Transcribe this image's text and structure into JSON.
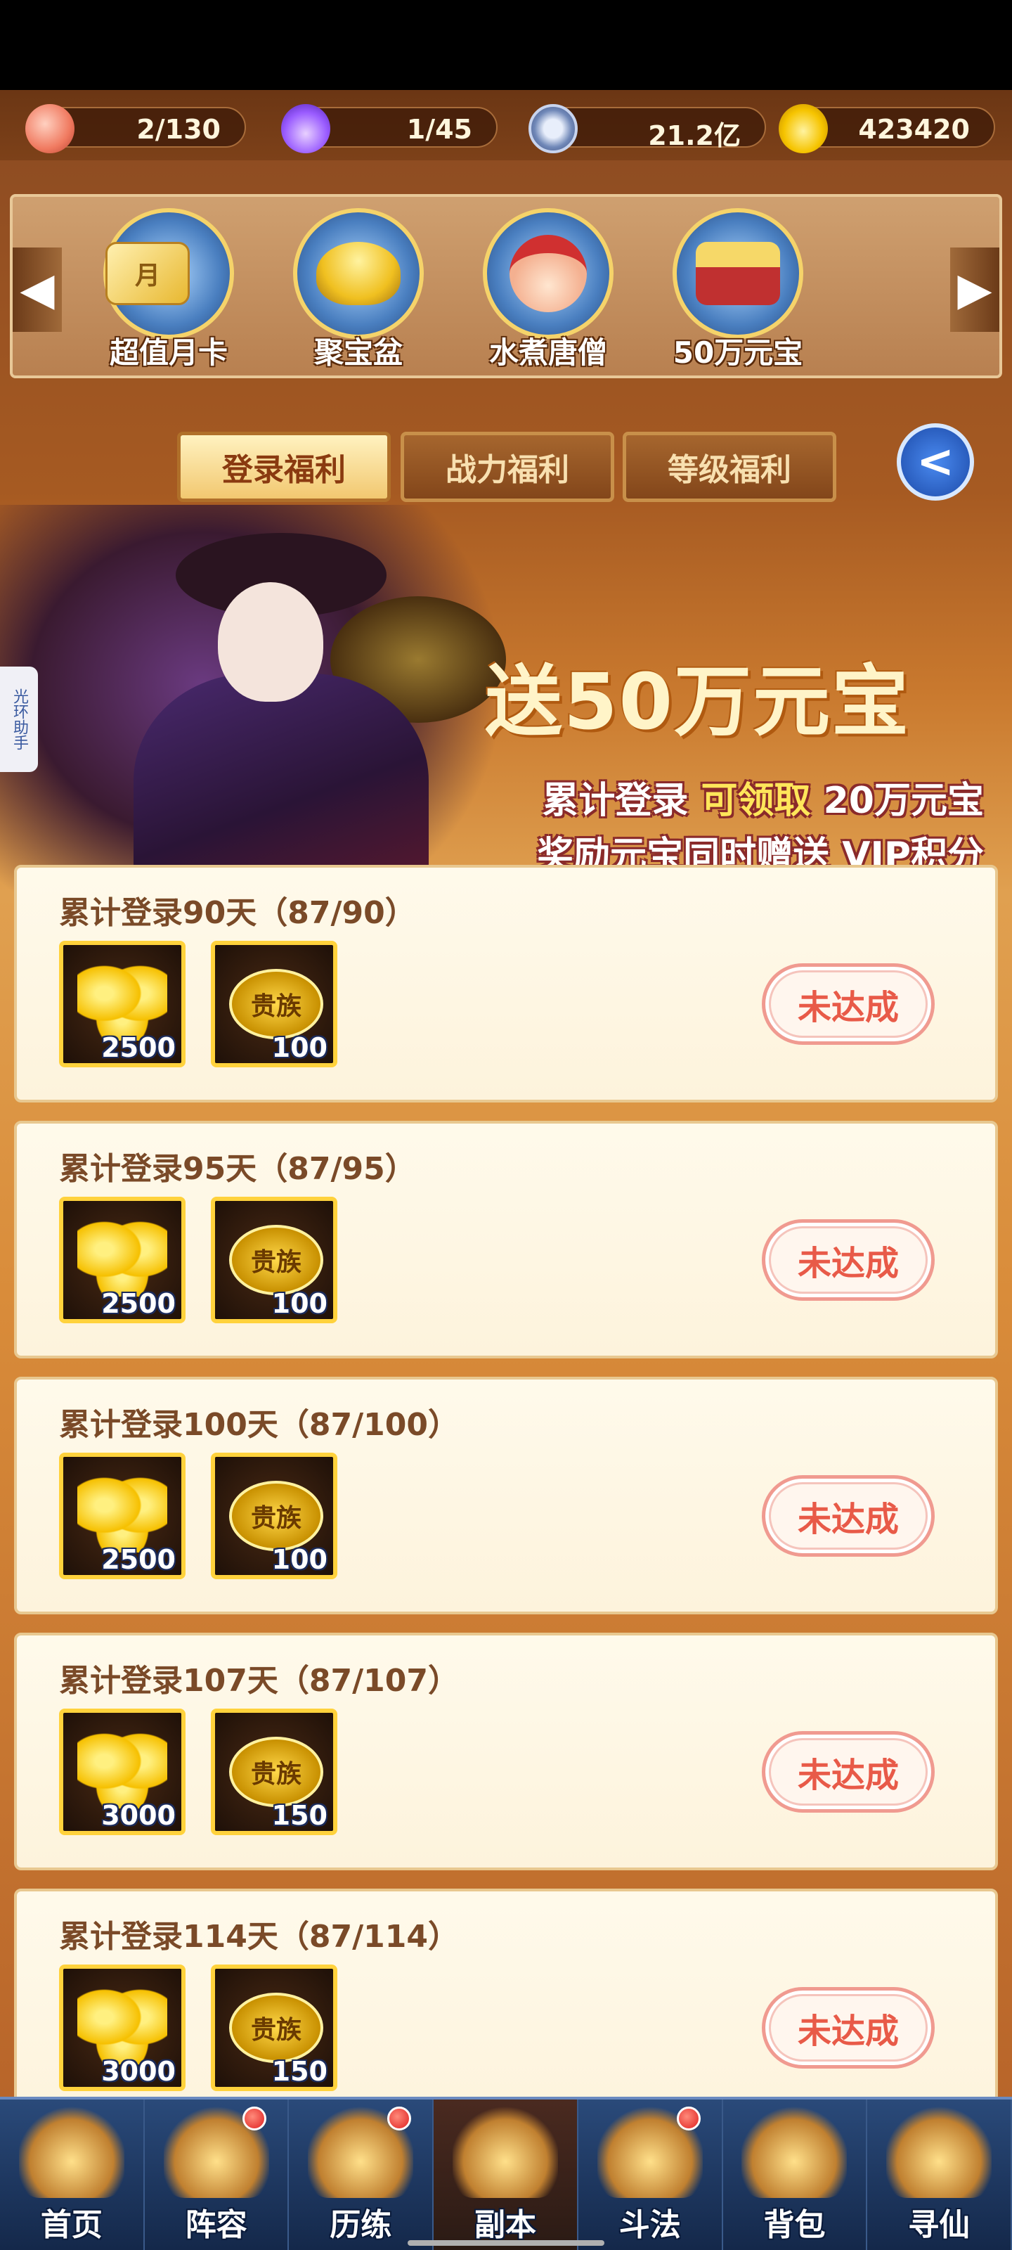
{
  "resources": [
    {
      "icon": "peach-icon",
      "value": "2/130"
    },
    {
      "icon": "flame-icon",
      "value": "1/45"
    },
    {
      "icon": "copper-coin-icon",
      "value": "21.2亿"
    },
    {
      "icon": "gold-ingot-icon",
      "value": "423420"
    }
  ],
  "shop_items": [
    {
      "label": "超值月卡",
      "badge": "月"
    },
    {
      "label": "聚宝盆"
    },
    {
      "label": "水煮唐僧"
    },
    {
      "label": "50万元宝"
    }
  ],
  "tabs": [
    {
      "label": "登录福利",
      "active": true
    },
    {
      "label": "战力福利",
      "active": false
    },
    {
      "label": "等级福利",
      "active": false
    }
  ],
  "side_tag": "光环助手",
  "banner": {
    "title": "送50万元宝",
    "line1_a": "累计登录",
    "line1_b": "可领取",
    "line1_c": "20万元宝",
    "line2_a": "奖励元宝同时赠送",
    "line2_b": "VIP积分"
  },
  "reward_cards": [
    {
      "title": "累计登录90天（87/90）",
      "rewards": [
        {
          "qty": "2500"
        },
        {
          "qty": "100",
          "label": "贵族"
        }
      ],
      "status": "未达成"
    },
    {
      "title": "累计登录95天（87/95）",
      "rewards": [
        {
          "qty": "2500"
        },
        {
          "qty": "100",
          "label": "贵族"
        }
      ],
      "status": "未达成"
    },
    {
      "title": "累计登录100天（87/100）",
      "rewards": [
        {
          "qty": "2500"
        },
        {
          "qty": "100",
          "label": "贵族"
        }
      ],
      "status": "未达成"
    },
    {
      "title": "累计登录107天（87/107）",
      "rewards": [
        {
          "qty": "3000"
        },
        {
          "qty": "150",
          "label": "贵族"
        }
      ],
      "status": "未达成"
    },
    {
      "title": "累计登录114天（87/114）",
      "rewards": [
        {
          "qty": "3000"
        },
        {
          "qty": "150",
          "label": "贵族"
        }
      ],
      "status": "未达成"
    }
  ],
  "nav": [
    {
      "label": "首页",
      "badge": false
    },
    {
      "label": "阵容",
      "badge": true
    },
    {
      "label": "历练",
      "badge": true
    },
    {
      "label": "副本",
      "badge": false,
      "active": true
    },
    {
      "label": "斗法",
      "badge": true
    },
    {
      "label": "背包",
      "badge": false
    },
    {
      "label": "寻仙",
      "badge": false
    }
  ],
  "colors": {
    "status_text": "#e85a48",
    "slot_border": "#ffd23c",
    "active_tab": "#f2c870"
  }
}
